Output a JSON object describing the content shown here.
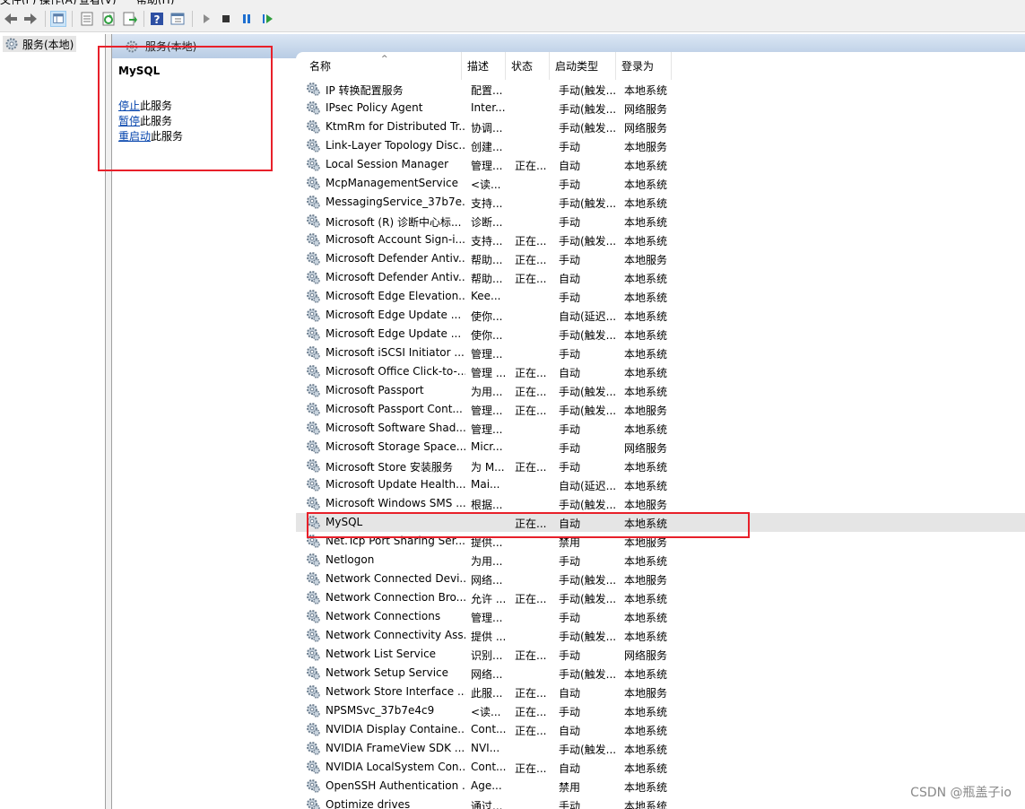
{
  "menu": {
    "items": [
      "文件(F)",
      "操作(A)",
      "查看(V)",
      "帮助(H)"
    ]
  },
  "toolbar": {
    "buttons": [
      "back-icon",
      "forward-icon",
      "show-hide-tree-icon",
      "properties-icon",
      "refresh-icon",
      "export-list-icon",
      "help-icon",
      "console-icon",
      "start-service-icon",
      "stop-service-icon",
      "pause-service-icon",
      "resume-service-icon"
    ]
  },
  "tree": {
    "root_label": "服务(本地)"
  },
  "header": {
    "title": "服务(本地)"
  },
  "detail": {
    "service_name": "MySQL",
    "actions": [
      {
        "link": "停止",
        "suffix": "此服务"
      },
      {
        "link": "暂停",
        "suffix": "此服务"
      },
      {
        "link": "重启动",
        "suffix": "此服务"
      }
    ]
  },
  "columns": [
    "名称",
    "描述",
    "状态",
    "启动类型",
    "登录为"
  ],
  "selected_row": "MySQL",
  "rows": [
    [
      "IP 转换配置服务",
      "配置...",
      "",
      "手动(触发...",
      "本地系统"
    ],
    [
      "IPsec Policy Agent",
      "Inter...",
      "",
      "手动(触发...",
      "网络服务"
    ],
    [
      "KtmRm for Distributed Tr...",
      "协调...",
      "",
      "手动(触发...",
      "网络服务"
    ],
    [
      "Link-Layer Topology Disc...",
      "创建...",
      "",
      "手动",
      "本地服务"
    ],
    [
      "Local Session Manager",
      "管理...",
      "正在...",
      "自动",
      "本地系统"
    ],
    [
      "McpManagementService",
      "<读...",
      "",
      "手动",
      "本地系统"
    ],
    [
      "MessagingService_37b7e...",
      "支持...",
      "",
      "手动(触发...",
      "本地系统"
    ],
    [
      "Microsoft (R) 诊断中心标...",
      "诊断...",
      "",
      "手动",
      "本地系统"
    ],
    [
      "Microsoft Account Sign-i...",
      "支持...",
      "正在...",
      "手动(触发...",
      "本地系统"
    ],
    [
      "Microsoft Defender Antiv...",
      "帮助...",
      "正在...",
      "手动",
      "本地服务"
    ],
    [
      "Microsoft Defender Antiv...",
      "帮助...",
      "正在...",
      "自动",
      "本地系统"
    ],
    [
      "Microsoft Edge Elevation...",
      "Kee...",
      "",
      "手动",
      "本地系统"
    ],
    [
      "Microsoft Edge Update ...",
      "使你...",
      "",
      "自动(延迟...",
      "本地系统"
    ],
    [
      "Microsoft Edge Update ...",
      "使你...",
      "",
      "手动(触发...",
      "本地系统"
    ],
    [
      "Microsoft iSCSI Initiator ...",
      "管理...",
      "",
      "手动",
      "本地系统"
    ],
    [
      "Microsoft Office Click-to-...",
      "管理 ...",
      "正在...",
      "自动",
      "本地系统"
    ],
    [
      "Microsoft Passport",
      "为用...",
      "正在...",
      "手动(触发...",
      "本地系统"
    ],
    [
      "Microsoft Passport Cont...",
      "管理...",
      "正在...",
      "手动(触发...",
      "本地服务"
    ],
    [
      "Microsoft Software Shad...",
      "管理...",
      "",
      "手动",
      "本地系统"
    ],
    [
      "Microsoft Storage Space...",
      "Micr...",
      "",
      "手动",
      "网络服务"
    ],
    [
      "Microsoft Store 安装服务",
      "为 M...",
      "正在...",
      "手动",
      "本地系统"
    ],
    [
      "Microsoft Update Health...",
      "Mai...",
      "",
      "自动(延迟...",
      "本地系统"
    ],
    [
      "Microsoft Windows SMS ...",
      "根据...",
      "",
      "手动(触发...",
      "本地服务"
    ],
    [
      "MySQL",
      "",
      "正在...",
      "自动",
      "本地系统"
    ],
    [
      "Net.Tcp Port Sharing Ser...",
      "提供...",
      "",
      "禁用",
      "本地服务"
    ],
    [
      "Netlogon",
      "为用...",
      "",
      "手动",
      "本地系统"
    ],
    [
      "Network Connected Devi...",
      "网络...",
      "",
      "手动(触发...",
      "本地服务"
    ],
    [
      "Network Connection Bro...",
      "允许 ...",
      "正在...",
      "手动(触发...",
      "本地系统"
    ],
    [
      "Network Connections",
      "管理...",
      "",
      "手动",
      "本地系统"
    ],
    [
      "Network Connectivity Ass...",
      "提供 ...",
      "",
      "手动(触发...",
      "本地系统"
    ],
    [
      "Network List Service",
      "识别...",
      "正在...",
      "手动",
      "网络服务"
    ],
    [
      "Network Setup Service",
      "网络...",
      "",
      "手动(触发...",
      "本地系统"
    ],
    [
      "Network Store Interface ...",
      "此服...",
      "正在...",
      "自动",
      "本地服务"
    ],
    [
      "NPSMSvc_37b7e4c9",
      "<读...",
      "正在...",
      "手动",
      "本地系统"
    ],
    [
      "NVIDIA Display Containe...",
      "Cont...",
      "正在...",
      "自动",
      "本地系统"
    ],
    [
      "NVIDIA FrameView SDK ...",
      "NVI...",
      "",
      "手动(触发...",
      "本地系统"
    ],
    [
      "NVIDIA LocalSystem Con...",
      "Cont...",
      "正在...",
      "自动",
      "本地系统"
    ],
    [
      "OpenSSH Authentication ...",
      "Age...",
      "",
      "禁用",
      "本地系统"
    ],
    [
      "Optimize drives",
      "通过...",
      "",
      "手动",
      "本地系统"
    ]
  ],
  "watermark": "CSDN @瓶盖子io",
  "colors": {
    "highlight": "#e8202a",
    "link": "#0645ad",
    "selected_row": "#e5e5e5",
    "header_gradient_top": "#dbe6f4",
    "header_gradient_bottom": "#b8cce4"
  }
}
